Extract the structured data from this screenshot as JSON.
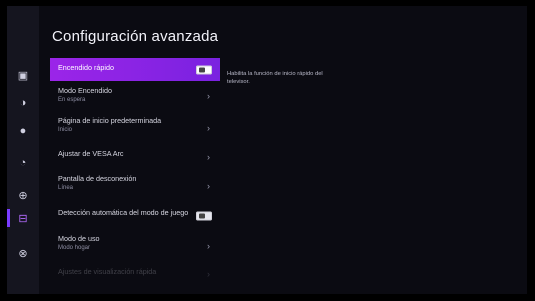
{
  "page_title": "Configuración avanzada",
  "menu": [
    {
      "label": "Encendido rápido",
      "sub": "",
      "control": "toggle",
      "state": "on",
      "selected": true
    },
    {
      "label": "Modo Encendido",
      "sub": "En espera",
      "control": "chevron",
      "selected": false
    },
    {
      "label": "Página de inicio predeterminada",
      "sub": "Inicio",
      "control": "chevron",
      "selected": false
    },
    {
      "label": "Ajustar de VESA Arc",
      "sub": "",
      "control": "chevron",
      "selected": false
    },
    {
      "label": "Pantalla de desconexión",
      "sub": "Línea",
      "control": "chevron",
      "selected": false
    },
    {
      "label": "Detección automática del modo de juego",
      "sub": "",
      "control": "toggle",
      "state": "off",
      "selected": false
    },
    {
      "label": "Modo de uso",
      "sub": "Modo hogar",
      "control": "chevron",
      "selected": false
    },
    {
      "label": "Ajustes de visualización rápida",
      "sub": "",
      "control": "chevron",
      "selected": false
    }
  ],
  "help_text": "Habilita la función de inicio rápido del televisor.",
  "icons": [
    "input-icon",
    "display-icon",
    "sound-icon",
    "network-icon",
    "system-icon",
    "advanced-icon",
    "support-icon"
  ],
  "colors": {
    "accent": "#8a24e6",
    "background": "#0b0b12",
    "rail": "#15151f"
  }
}
